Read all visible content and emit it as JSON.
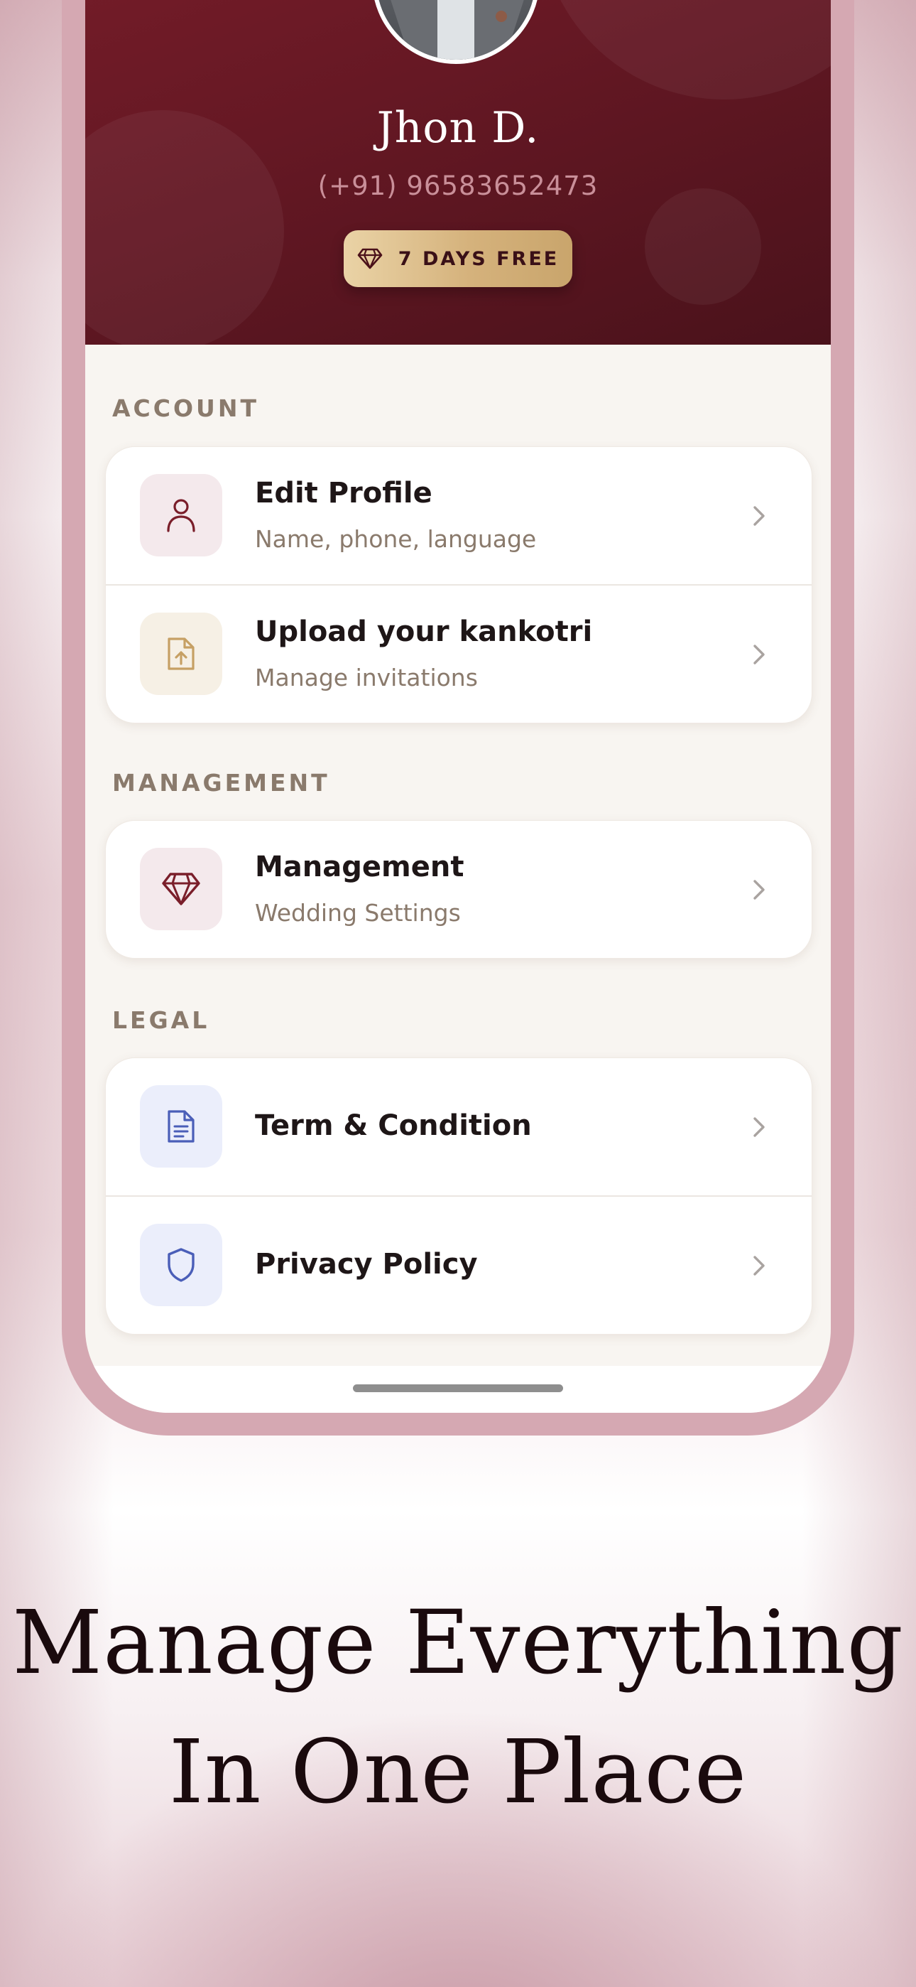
{
  "profile": {
    "name": "Jhon D.",
    "phone": "(+91) 96583652473",
    "badge_label": "7 DAYS FREE"
  },
  "sections": {
    "account": {
      "label": "ACCOUNT",
      "items": [
        {
          "title": "Edit Profile",
          "subtitle": "Name, phone, language",
          "icon": "user-icon"
        },
        {
          "title": "Upload your kankotri",
          "subtitle": "Manage invitations",
          "icon": "file-upload-icon"
        }
      ]
    },
    "management": {
      "label": "MANAGEMENT",
      "items": [
        {
          "title": "Management",
          "subtitle": "Wedding Settings",
          "icon": "diamond-icon"
        }
      ]
    },
    "legal": {
      "label": "LEGAL",
      "items": [
        {
          "title": "Term & Condition",
          "icon": "document-icon"
        },
        {
          "title": "Privacy Policy",
          "icon": "shield-icon"
        }
      ]
    }
  },
  "headline": {
    "line1": "Manage Everything",
    "line2": "In One Place"
  },
  "colors": {
    "maroon": "#661824",
    "gold": "#d5b27c",
    "blue_icon": "#4a5eb8",
    "frame_pink": "#d5a8b2"
  }
}
